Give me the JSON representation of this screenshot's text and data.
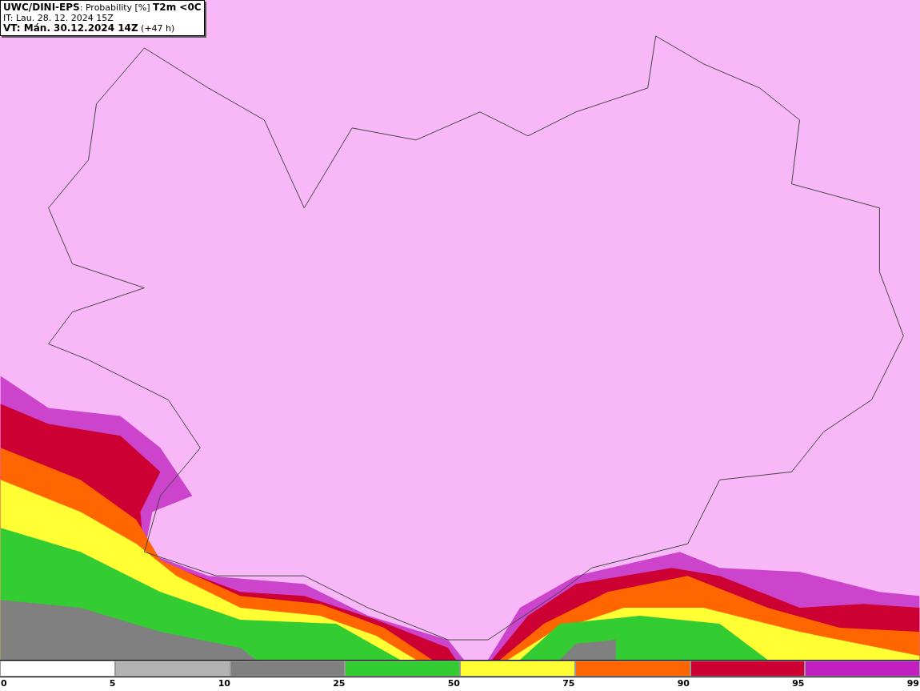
{
  "header": {
    "lines": [
      "**UWC/DINI-EPS**: Probability [%] **T2m <0C**",
      "IT: Lau. 28. 12. 2024 15Z",
      "**VT: Mán. 30.12.2024 14Z** (+47 h)"
    ]
  },
  "legend": {
    "segments": [
      {
        "color": "#ffffff"
      },
      {
        "color": "#b3b3b3"
      },
      {
        "color": "#808080"
      },
      {
        "color": "#33cc33"
      },
      {
        "color": "#ffff33"
      },
      {
        "color": "#ff6600"
      },
      {
        "color": "#cc0033"
      },
      {
        "color": "#c020c0"
      }
    ],
    "ticks": [
      "0",
      "5",
      "10",
      "25",
      "50",
      "75",
      "90",
      "95",
      "99"
    ]
  }
}
